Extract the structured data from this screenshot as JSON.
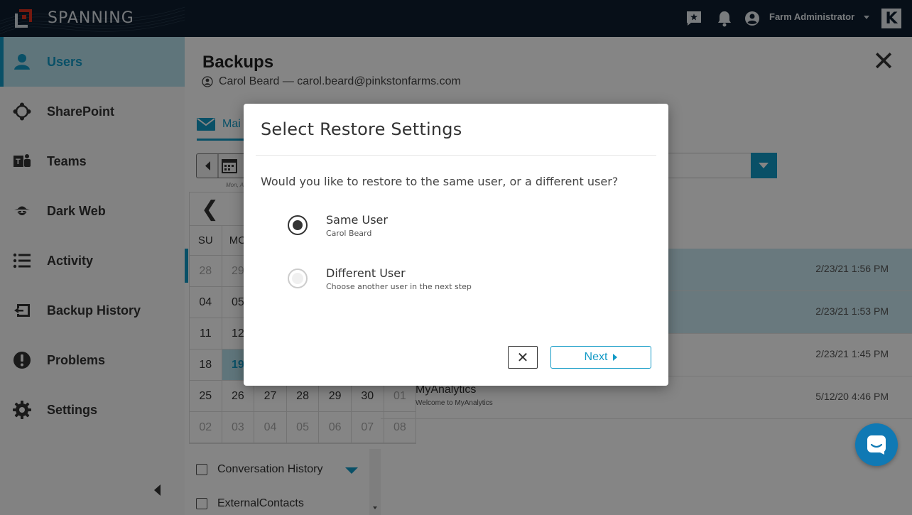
{
  "app": {
    "brand": "SPANNING",
    "user_name": "Farm Administrator",
    "k_logo": "K",
    "accent_color": "#139ac6"
  },
  "sidebar": {
    "items": [
      {
        "label": "Users",
        "icon": "user-icon",
        "active": true
      },
      {
        "label": "SharePoint",
        "icon": "sharepoint-icon"
      },
      {
        "label": "Teams",
        "icon": "teams-icon"
      },
      {
        "label": "Dark Web",
        "icon": "dark-web-icon"
      },
      {
        "label": "Activity",
        "icon": "list-icon"
      },
      {
        "label": "Backup History",
        "icon": "backup-history-icon"
      },
      {
        "label": "Problems",
        "icon": "alert-icon"
      },
      {
        "label": "Settings",
        "icon": "gear-icon"
      }
    ]
  },
  "main": {
    "title": "Backups",
    "subtitle": "Carol Beard — carol.beard@pinkstonfarms.com",
    "tab_mail_label": "Mai",
    "date_hint": "Mon, A",
    "calendar": {
      "dow": [
        "SU",
        "MO"
      ],
      "rows": [
        [
          "28",
          "29",
          "",
          "",
          "",
          "",
          ""
        ],
        [
          "04",
          "05",
          "",
          "",
          "",
          "",
          ""
        ],
        [
          "11",
          "12",
          "",
          "",
          "",
          "",
          ""
        ],
        [
          "18",
          "19",
          "",
          "",
          "",
          "",
          ""
        ],
        [
          "25",
          "26",
          "27",
          "28",
          "29",
          "30",
          "01"
        ],
        [
          "02",
          "03",
          "04",
          "05",
          "06",
          "07",
          "08"
        ]
      ]
    },
    "folders": [
      {
        "label": "Conversation History"
      },
      {
        "label": "ExternalContacts"
      }
    ],
    "mail_rows": [
      {
        "date": "2/23/21 1:56 PM",
        "subject": "",
        "preview": "",
        "highlight": true
      },
      {
        "date": "2/23/21 1:53 PM",
        "subject": "",
        "preview": "",
        "highlight": true
      },
      {
        "date": "2/23/21 1:45 PM",
        "subject": "",
        "preview": "",
        "highlight": false
      },
      {
        "date": "5/12/20 4:46 PM",
        "subject": "MyAnalytics",
        "preview": "Welcome to MyAnalytics",
        "highlight": false
      }
    ]
  },
  "modal": {
    "title": "Select Restore Settings",
    "question": "Would you like to restore to the same user, or a different user?",
    "options": [
      {
        "label": "Same User",
        "sub": "Carol Beard",
        "selected": true
      },
      {
        "label": "Different User",
        "sub": "Choose another user in the next step",
        "selected": false
      }
    ],
    "cancel_symbol": "✕",
    "next_label": "Next"
  }
}
